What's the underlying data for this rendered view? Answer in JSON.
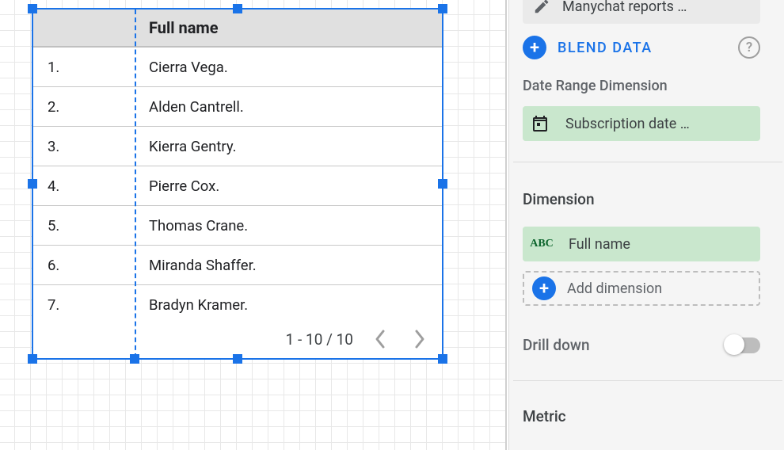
{
  "datasource": {
    "name": "Manychat reports …"
  },
  "blend": {
    "label": "BLEND DATA"
  },
  "date_range_dimension": {
    "section_label": "Date Range Dimension",
    "value": "Subscription date …"
  },
  "dimension": {
    "section_label": "Dimension",
    "chip_icon": "ABC",
    "value": "Full name",
    "add_label": "Add dimension"
  },
  "drill_down": {
    "label": "Drill down"
  },
  "metric": {
    "label": "Metric"
  },
  "table": {
    "header": "Full name",
    "rows": [
      {
        "idx": "1.",
        "name": "Cierra Vega."
      },
      {
        "idx": "2.",
        "name": "Alden Cantrell."
      },
      {
        "idx": "3.",
        "name": "Kierra Gentry."
      },
      {
        "idx": "4.",
        "name": "Pierre Cox."
      },
      {
        "idx": "5.",
        "name": "Thomas Crane."
      },
      {
        "idx": "6.",
        "name": "Miranda Shaffer."
      },
      {
        "idx": "7.",
        "name": "Bradyn Kramer."
      }
    ],
    "pager": "1 - 10 / 10"
  }
}
